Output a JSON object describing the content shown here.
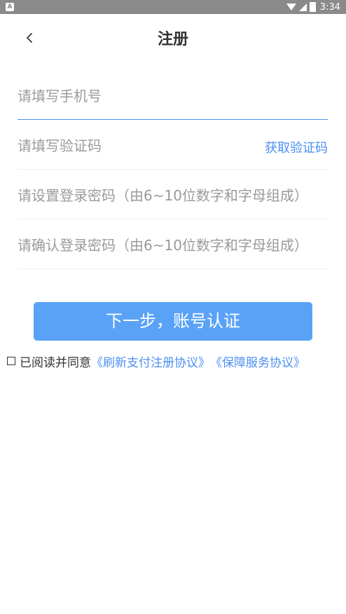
{
  "status_bar": {
    "app_icon_letter": "A",
    "time": "3:34"
  },
  "header": {
    "title": "注册"
  },
  "form": {
    "phone_placeholder": "请填写手机号",
    "code_placeholder": "请填写验证码",
    "get_code_label": "获取验证码",
    "password_placeholder": "请设置登录密码（由6~10位数字和字母组成）",
    "confirm_password_placeholder": "请确认登录密码（由6~10位数字和字母组成）"
  },
  "next_button_label": "下一步，账号认证",
  "agreement": {
    "prefix": "已阅读并同意",
    "link_1": "《刷新支付注册协议》",
    "link_2": "《保障服务协议》"
  }
}
